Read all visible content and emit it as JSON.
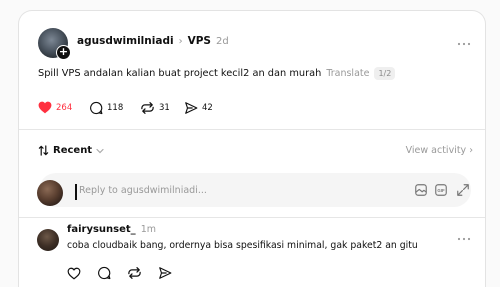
{
  "post": {
    "author": "agusdwimilniadi",
    "separator": "›",
    "topic": "VPS",
    "time": "2d",
    "text": "Spill VPS andalan kalian buat project kecil2 an dan murah",
    "translate": "Translate",
    "translate_page": "1/2",
    "likes": "264",
    "comments": "118",
    "reposts": "31",
    "shares": "42",
    "like_color": "#ff3040"
  },
  "sort": {
    "label": "Recent",
    "activity": "View activity ›"
  },
  "reply": {
    "placeholder": "Reply to agusdwimilniadi..."
  },
  "comment": {
    "author": "fairysunset_",
    "time": "1m",
    "text": "coba cloudbaik bang, ordernya bisa spesifikasi minimal, gak paket2 an gitu"
  }
}
